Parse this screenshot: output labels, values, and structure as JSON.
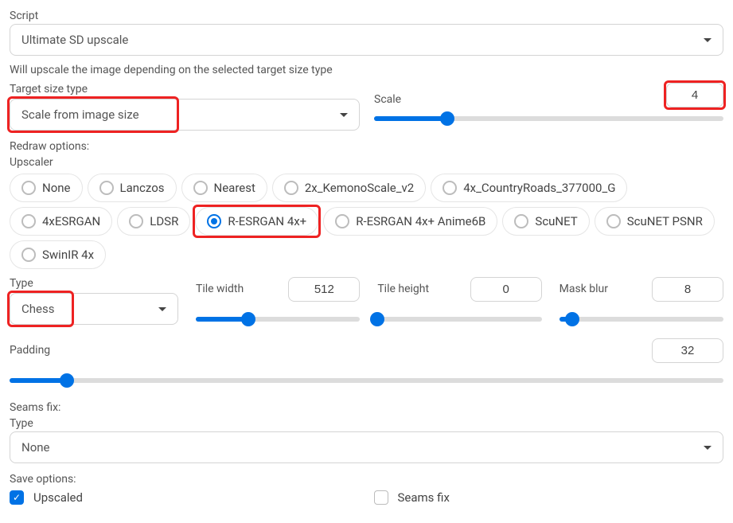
{
  "script": {
    "label": "Script",
    "value": "Ultimate SD upscale"
  },
  "description": "Will upscale the image depending on the selected target size type",
  "target": {
    "label": "Target size type",
    "value": "Scale from image size"
  },
  "scale": {
    "label": "Scale",
    "value": "4",
    "fill_pct": 21
  },
  "redraw_label": "Redraw options:",
  "upscaler": {
    "label": "Upscaler",
    "options": [
      "None",
      "Lanczos",
      "Nearest",
      "2x_KemonoScale_v2",
      "4x_CountryRoads_377000_G",
      "4xESRGAN",
      "LDSR",
      "R-ESRGAN 4x+",
      "R-ESRGAN 4x+ Anime6B",
      "ScuNET",
      "ScuNET PSNR",
      "SwinIR 4x"
    ],
    "selected": "R-ESRGAN 4x+"
  },
  "type": {
    "label": "Type",
    "value": "Chess"
  },
  "tile_width": {
    "label": "Tile width",
    "value": "512",
    "fill_pct": 32
  },
  "tile_height": {
    "label": "Tile height",
    "value": "0",
    "fill_pct": 0
  },
  "mask_blur": {
    "label": "Mask blur",
    "value": "8",
    "fill_pct": 8
  },
  "padding": {
    "label": "Padding",
    "value": "32",
    "fill_pct": 8
  },
  "seams_label": "Seams fix:",
  "seams_type": {
    "label": "Type",
    "value": "None"
  },
  "save_label": "Save options:",
  "save_upscaled": {
    "label": "Upscaled",
    "checked": true
  },
  "save_seams": {
    "label": "Seams fix",
    "checked": false
  }
}
